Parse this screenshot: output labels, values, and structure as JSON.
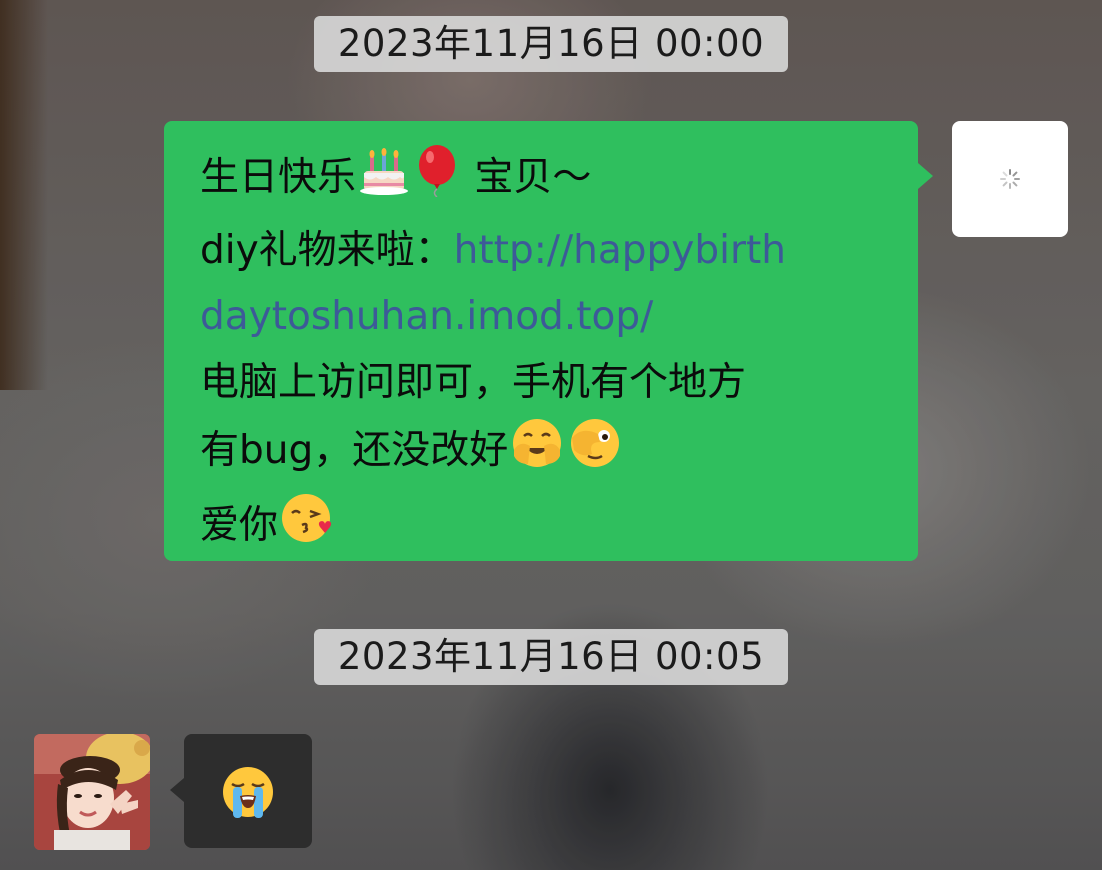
{
  "timestamps": {
    "first": "2023年11月16日 00:00",
    "second": "2023年11月16日 00:05"
  },
  "sent_message": {
    "line1_text": "生日快乐",
    "line1_suffix": "宝贝～",
    "line2_prefix": "diy礼物来啦：",
    "link_part1": "http://happybirth",
    "link_part2": "daytoshuhan.imod.top/",
    "line4": "电脑上访问即可，手机有个地方",
    "line5": "有bug，还没改好",
    "line6": "爱你",
    "emojis": [
      "birthday-cake-icon",
      "balloon-icon",
      "face-holding-back-tears-icon",
      "face-with-peeking-eye-icon",
      "face-blowing-kiss-icon"
    ]
  },
  "received_message": {
    "emoji": "loudly-crying-face-icon"
  },
  "colors": {
    "sent_bubble": "#2fbf5e",
    "received_bubble": "#2d2d2d",
    "link": "#3d5a98",
    "timestamp_chip": "#d6d6d6"
  }
}
